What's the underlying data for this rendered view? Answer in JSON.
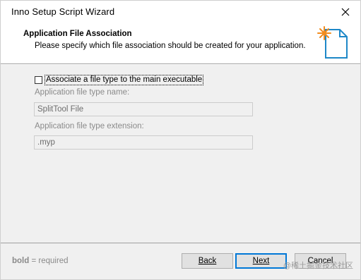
{
  "window": {
    "title": "Inno Setup Script Wizard"
  },
  "header": {
    "title": "Application File Association",
    "subtitle": "Please specify which file association should be created for your application."
  },
  "form": {
    "associate_checkbox": {
      "label": "Associate a file type to the main executable",
      "checked": false
    },
    "type_name_label": "Application file type name:",
    "type_name_value": "SplitTool File",
    "extension_label": "Application file type extension:",
    "extension_value": ".myp"
  },
  "footer": {
    "hint_bold": "bold",
    "hint_rest": " = required",
    "back_label": "Back",
    "next_label": "Next",
    "cancel_label": "Cancel",
    "watermark": "@稀土掘金技术社区"
  },
  "icons": {
    "close": "close-icon",
    "wizard": "document-star-icon"
  },
  "colors": {
    "accent": "#0078d7",
    "disabled_text": "#8a8a8a",
    "star": "#f28c1e",
    "document": "#1e88c8"
  }
}
